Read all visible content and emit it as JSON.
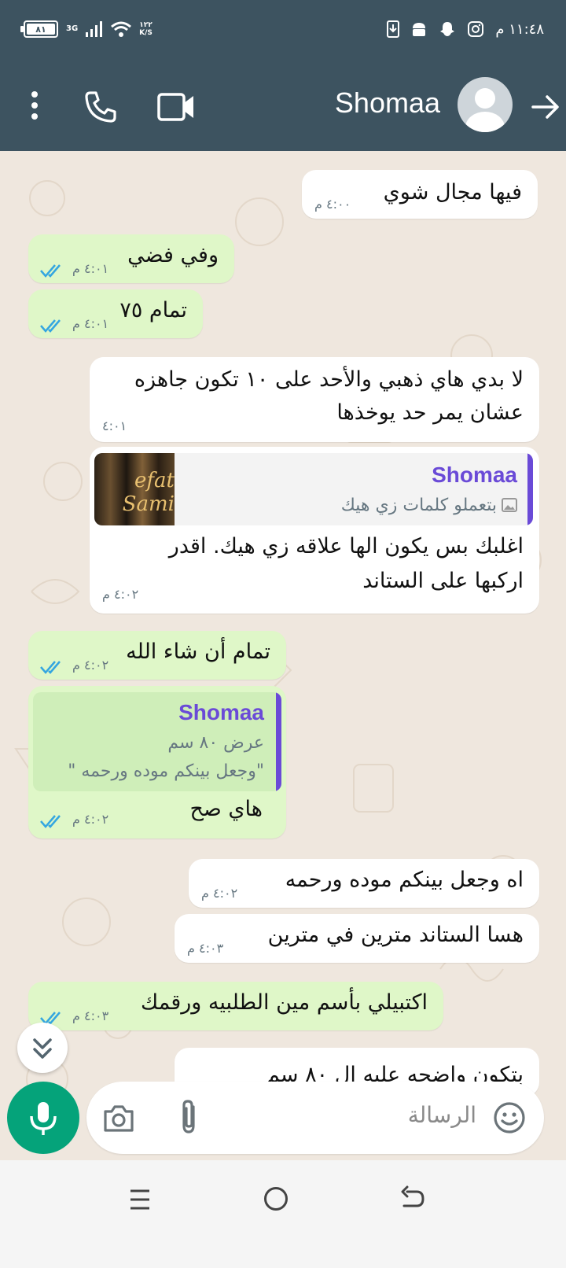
{
  "status_bar": {
    "battery_level": "٨١",
    "network": "3G",
    "speed_value": "١٢٢",
    "speed_unit": "K/S",
    "time": "١١:٤٨ م"
  },
  "header": {
    "contact_name": "Shomaa"
  },
  "messages": [
    {
      "id": 1,
      "direction": "incoming",
      "text": "فيها مجال شوي",
      "time": "٤:٠٠ م"
    },
    {
      "id": 2,
      "direction": "outgoing",
      "text": "وفي فضي",
      "time": "٤:٠١ م",
      "read": true
    },
    {
      "id": 3,
      "direction": "outgoing",
      "text": "تمام ٧٥",
      "time": "٤:٠١ م",
      "read": true
    },
    {
      "id": 4,
      "direction": "incoming",
      "text_line1": "لا بدي هاي ذهبي والأحد على ١٠ تكون جاهزه",
      "text_line2": "عشان يمر حد يوخذها",
      "time": "٤:٠١"
    },
    {
      "id": 5,
      "direction": "incoming",
      "quote_name": "Shomaa",
      "quote_text": "بتعملو كلمات زي هيك",
      "quote_thumb_text": "efat Sami",
      "text_line1": "اغلبك بس يكون الها علاقه زي هيك. اقدر",
      "text_line2": "اركبها على الستاند",
      "time": "٤:٠٢ م"
    },
    {
      "id": 6,
      "direction": "outgoing",
      "text": "تمام أن شاء الله",
      "time": "٤:٠٢ م",
      "read": true
    },
    {
      "id": 7,
      "direction": "outgoing",
      "quote_name": "Shomaa",
      "quote_line1": "عرض ٨٠ سم",
      "quote_line2": "\"وجعل بينكم موده ورحمه \"",
      "text": "هاي صح",
      "time": "٤:٠٢ م",
      "read": true
    },
    {
      "id": 8,
      "direction": "incoming",
      "text": "اه وجعل بينكم موده ورحمه",
      "time": "٤:٠٢ م"
    },
    {
      "id": 9,
      "direction": "incoming",
      "text": "هسا الستاند مترين في مترين",
      "time": "٤:٠٣ م"
    },
    {
      "id": 10,
      "direction": "outgoing",
      "text": "اكتبيلي بأسم مين الطلبيه ورقمك",
      "time": "٤:٠٣ م",
      "read": true
    },
    {
      "id": 11,
      "direction": "incoming",
      "text": "بتكون واضحه عليه ال ٨٠ سم"
    }
  ],
  "composer": {
    "placeholder": "الرسالة"
  },
  "colors": {
    "header_bg": "#3d5360",
    "outgoing_bubble": "#dff7c8",
    "incoming_bubble": "#ffffff",
    "accent_green": "#05a37a",
    "quote_name": "#6a4ad7",
    "read_ticks": "#34a6e0"
  },
  "icons": {
    "more": "more-vertical-icon",
    "call": "phone-icon",
    "video": "video-camera-icon",
    "back": "arrow-icon",
    "mic": "microphone-icon",
    "camera": "camera-icon",
    "attach": "paperclip-icon",
    "emoji": "smiley-icon",
    "scroll_down": "double-chevron-down-icon"
  }
}
